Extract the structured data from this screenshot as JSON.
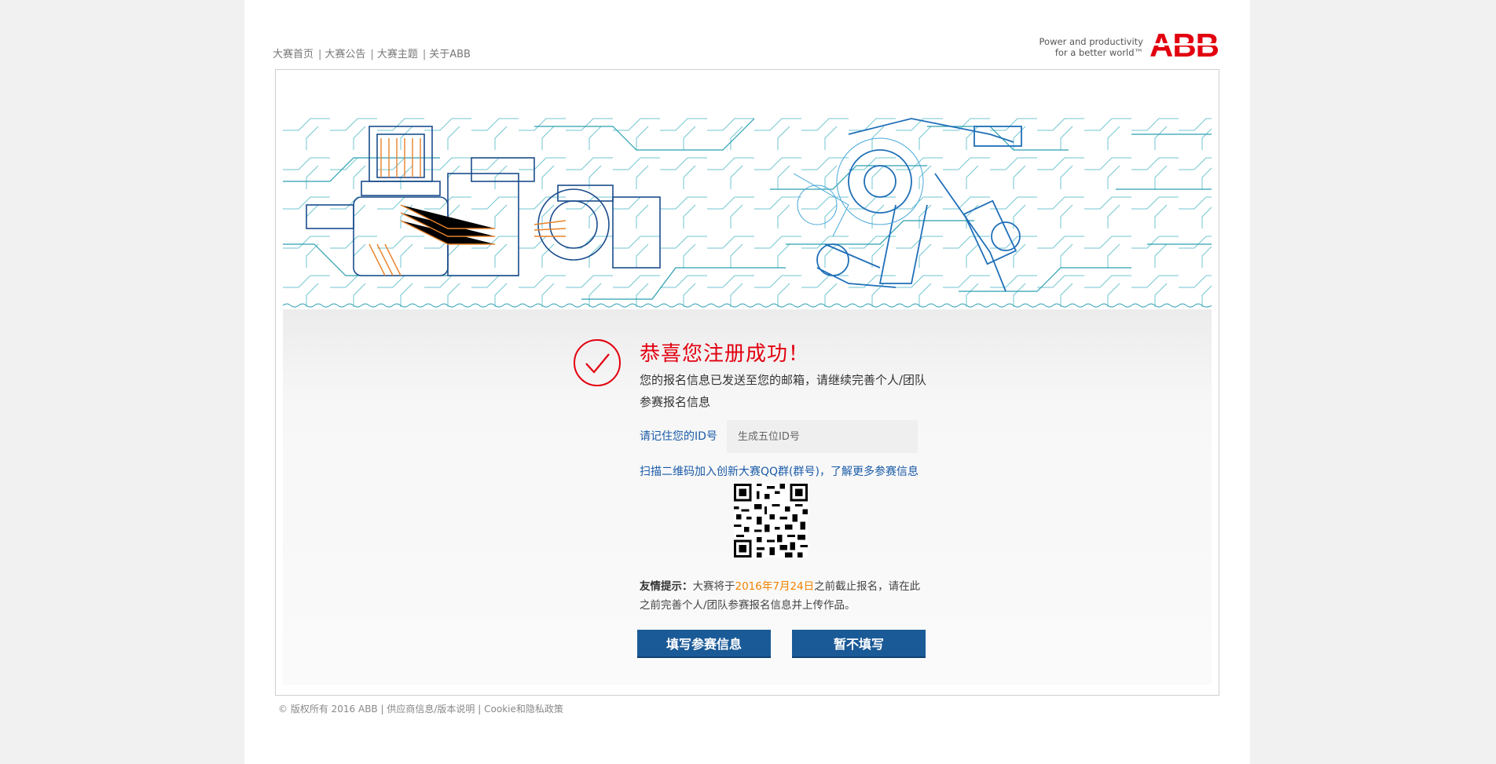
{
  "nav": {
    "items": [
      "大赛首页",
      "大赛公告",
      "大赛主题",
      "关于ABB"
    ],
    "separator": "|"
  },
  "brand": {
    "tagline_line1": "Power and productivity",
    "tagline_line2": "for a better world™",
    "logo_text": "ABB",
    "logo_color": "#e2000f"
  },
  "success": {
    "title": "恭喜您注册成功！",
    "description": "您的报名信息已发送至您的邮箱，请继续完善个人/团队参赛报名信息",
    "id_label": "请记住您的ID号",
    "id_placeholder": "生成五位ID号",
    "qq_text": "扫描二维码加入创新大赛QQ群(群号)，了解更多参赛信息",
    "tip_label": "友情提示：",
    "tip_before": "大赛将于",
    "tip_date": "2016年7月24日",
    "tip_after": "之前截止报名，请在此之前完善个人/团队参赛报名信息并上传作品。"
  },
  "buttons": {
    "fill": "填写参赛信息",
    "skip": "暂不填写"
  },
  "footer": {
    "copyright": "© 版权所有 2016 ABB",
    "supplier": "供应商信息/版本说明",
    "cookie": "Cookie和隐私政策",
    "separator": "|"
  },
  "colors": {
    "accent_red": "#e2000f",
    "link_blue": "#1a5ba8",
    "button_blue": "#1a5a97",
    "date_orange": "#f08300"
  }
}
